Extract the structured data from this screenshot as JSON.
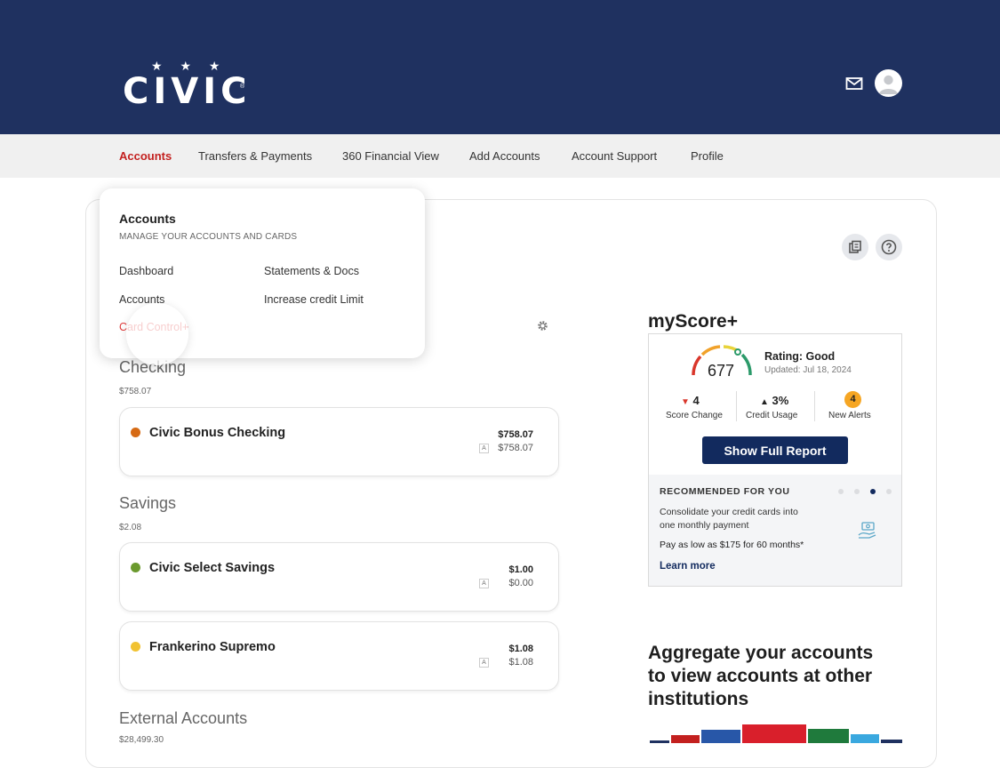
{
  "brand": {
    "name": "CIVIC",
    "registered": "®",
    "stars": "★ ★ ★"
  },
  "header": {
    "mail_icon": "mail-icon",
    "avatar_icon": "user-avatar-icon"
  },
  "nav": {
    "items": [
      {
        "label": "Accounts",
        "active": true
      },
      {
        "label": "Transfers & Payments"
      },
      {
        "label": "360 Financial View"
      },
      {
        "label": "Add Accounts"
      },
      {
        "label": "Account Support"
      },
      {
        "label": "Profile"
      }
    ]
  },
  "dropdown": {
    "title": "Accounts",
    "subtitle": "MANAGE YOUR ACCOUNTS AND CARDS",
    "links": {
      "dashboard": "Dashboard",
      "statements": "Statements & Docs",
      "accounts": "Accounts",
      "increase_limit": "Increase credit Limit",
      "card_control": "Card Control+"
    }
  },
  "sections": {
    "checking": {
      "title": "Checking",
      "total": "$758.07",
      "accounts": [
        {
          "name": "Civic Bonus Checking",
          "balance": "$758.07",
          "available": "$758.07",
          "badge": "A",
          "color": "#d66a14"
        }
      ]
    },
    "savings": {
      "title": "Savings",
      "total": "$2.08",
      "accounts": [
        {
          "name": "Civic Select Savings",
          "balance": "$1.00",
          "available": "$0.00",
          "badge": "A",
          "color": "#6b9a2e"
        },
        {
          "name": "Frankerino Supremo",
          "balance": "$1.08",
          "available": "$1.08",
          "badge": "A",
          "color": "#f1c232"
        }
      ]
    },
    "external": {
      "title": "External Accounts",
      "total": "$28,499.30"
    }
  },
  "myscore": {
    "title": "myScore+",
    "score": "677",
    "rating": "Rating: Good",
    "updated": "Updated: Jul 18, 2024",
    "stats": {
      "score_change": {
        "value": "4",
        "label": "Score Change",
        "direction": "down"
      },
      "credit_usage": {
        "value": "3%",
        "label": "Credit Usage",
        "direction": "up"
      },
      "alerts": {
        "value": "4",
        "label": "New Alerts"
      }
    },
    "button": "Show Full Report",
    "recommended": {
      "heading": "RECOMMENDED FOR YOU",
      "line1": "Consolidate your credit cards into",
      "line2": "one monthly payment",
      "offer": "Pay as low as $175 for 60 months*",
      "link": "Learn more",
      "active_dot": 3,
      "dot_count": 4
    }
  },
  "aggregate": {
    "line1": "Aggregate your accounts",
    "line2": "to view accounts at other",
    "line3": "institutions"
  },
  "colors": {
    "header_bg": "#1f3160",
    "accent_red": "#c3201f",
    "button_navy": "#122a5e",
    "alert_orange": "#f6a623"
  }
}
